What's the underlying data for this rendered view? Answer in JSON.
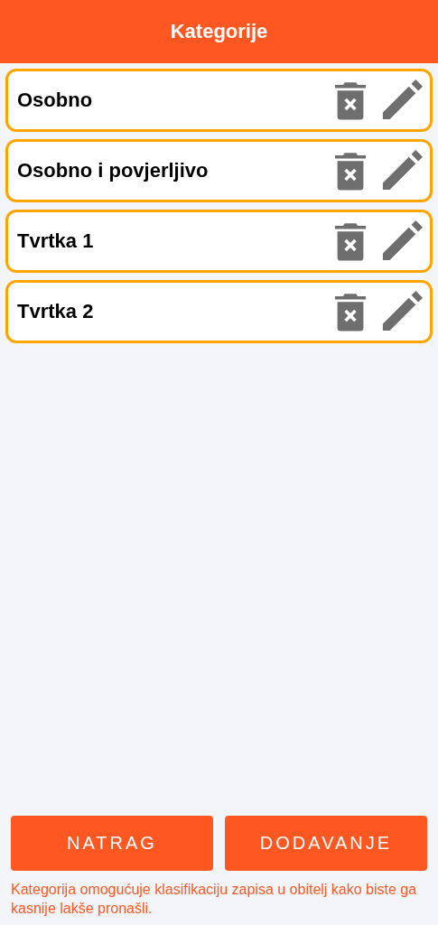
{
  "header": {
    "title": "Kategorije"
  },
  "categories": [
    {
      "name": "Osobno"
    },
    {
      "name": "Osobno i povjerljivo"
    },
    {
      "name": "Tvrtka 1"
    },
    {
      "name": "Tvrtka 2"
    }
  ],
  "buttons": [
    "NATRAG",
    "DODAVANJE"
  ],
  "note": "Kategorija omogućuje klasifikaciju zapisa u obitelj kako biste ga kasnije lakše pronašli."
}
